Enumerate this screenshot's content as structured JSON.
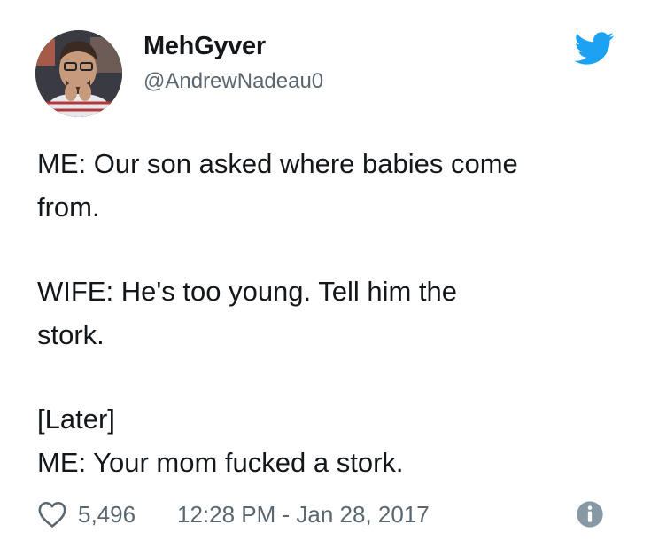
{
  "tweet": {
    "author": {
      "display_name": "MehGyver",
      "handle": "@AndrewNadeau0"
    },
    "text_lines": [
      "ME: Our son asked where babies come",
      "from.",
      "WIFE: He's too young. Tell him the",
      "stork.",
      "[Later]",
      "ME: Your mom fucked a stork."
    ],
    "likes": "5,496",
    "timestamp": "12:28 PM - Jan 28, 2017"
  },
  "icons": {
    "brand": "twitter-bird-icon",
    "like": "heart-icon",
    "info": "info-icon"
  },
  "colors": {
    "twitter_blue": "#1da1f2",
    "text": "#14171a",
    "secondary_text": "#5b6770",
    "info_icon": "#8899a6"
  }
}
